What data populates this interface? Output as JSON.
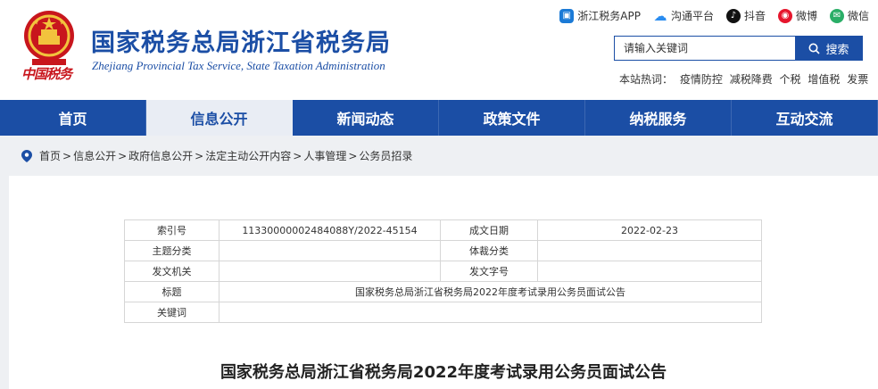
{
  "header": {
    "site_title": "国家税务总局浙江省税务局",
    "site_subtitle": "Zhejiang Provincial Tax Service, State Taxation Administration",
    "brand_mark": "中国税务",
    "top_links": [
      {
        "label": "浙江税务APP",
        "icon": "app-icon",
        "color": "#1b7ad6"
      },
      {
        "label": "沟通平台",
        "icon": "cloud-icon",
        "color": "#2a8cf0"
      },
      {
        "label": "抖音",
        "icon": "douyin-icon",
        "color": "#111111"
      },
      {
        "label": "微博",
        "icon": "weibo-icon",
        "color": "#e6162d"
      },
      {
        "label": "微信",
        "icon": "wechat-icon",
        "color": "#2aae67"
      }
    ],
    "search": {
      "placeholder": "请输入关键词",
      "button_label": "搜索"
    },
    "hotwords_label": "本站热词：",
    "hotwords": [
      "疫情防控",
      "减税降费",
      "个税",
      "增值税",
      "发票"
    ]
  },
  "nav": {
    "tabs": [
      "首页",
      "信息公开",
      "新闻动态",
      "政策文件",
      "纳税服务",
      "互动交流"
    ],
    "active": "信息公开"
  },
  "breadcrumb": [
    "首页",
    "信息公开",
    "政府信息公开",
    "法定主动公开内容",
    "人事管理",
    "公务员招录"
  ],
  "meta_table": {
    "index_label": "索引号",
    "index_value": "113300000024840​88Y/2022-45154",
    "date_label": "成文日期",
    "date_value": "2022-02-23",
    "topic_label": "主题分类",
    "topic_value": "",
    "genre_label": "体裁分类",
    "genre_value": "",
    "issuer_label": "发文机关",
    "issuer_value": "",
    "docno_label": "发文字号",
    "docno_value": "",
    "title_label": "标题",
    "title_value": "国家税务总局浙江省税务局2022年度考试录用公务员面试公告",
    "keywords_label": "关键词",
    "keywords_value": ""
  },
  "article": {
    "title": "国家税务总局浙江省税务局2022年度考试录用公务员面试公告"
  },
  "colors": {
    "brand_blue": "#1b4ea5",
    "emblem_red": "#c8161d",
    "emblem_gold": "#f2c33d"
  }
}
